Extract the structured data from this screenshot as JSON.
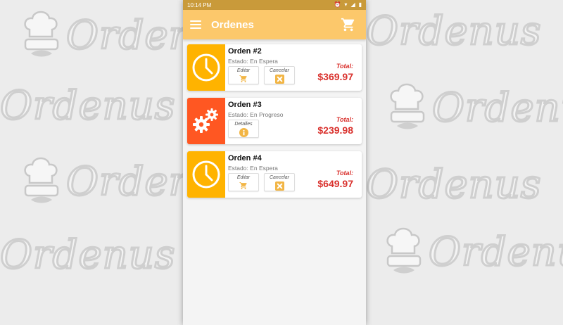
{
  "background": {
    "watermark_text": "Ordenus"
  },
  "statusbar": {
    "time": "10:14 PM"
  },
  "appbar": {
    "title": "Ordenes"
  },
  "orders": [
    {
      "title": "Orden #2",
      "status": "Estado: En Espera",
      "state": "waiting",
      "actions": [
        "Editar",
        "Cancelar"
      ],
      "total_label": "Total:",
      "total": "$369.97"
    },
    {
      "title": "Orden #3",
      "status": "Estado: En Progreso",
      "state": "progress",
      "actions": [
        "Detalles"
      ],
      "total_label": "Total:",
      "total": "$239.98"
    },
    {
      "title": "Orden #4",
      "status": "Estado: En Espera",
      "state": "waiting",
      "actions": [
        "Editar",
        "Cancelar"
      ],
      "total_label": "Total:",
      "total": "$649.97"
    }
  ],
  "colors": {
    "appbar": "#fcc86b",
    "waiting": "#ffb300",
    "progress": "#ff5722",
    "total": "#d9302c"
  }
}
